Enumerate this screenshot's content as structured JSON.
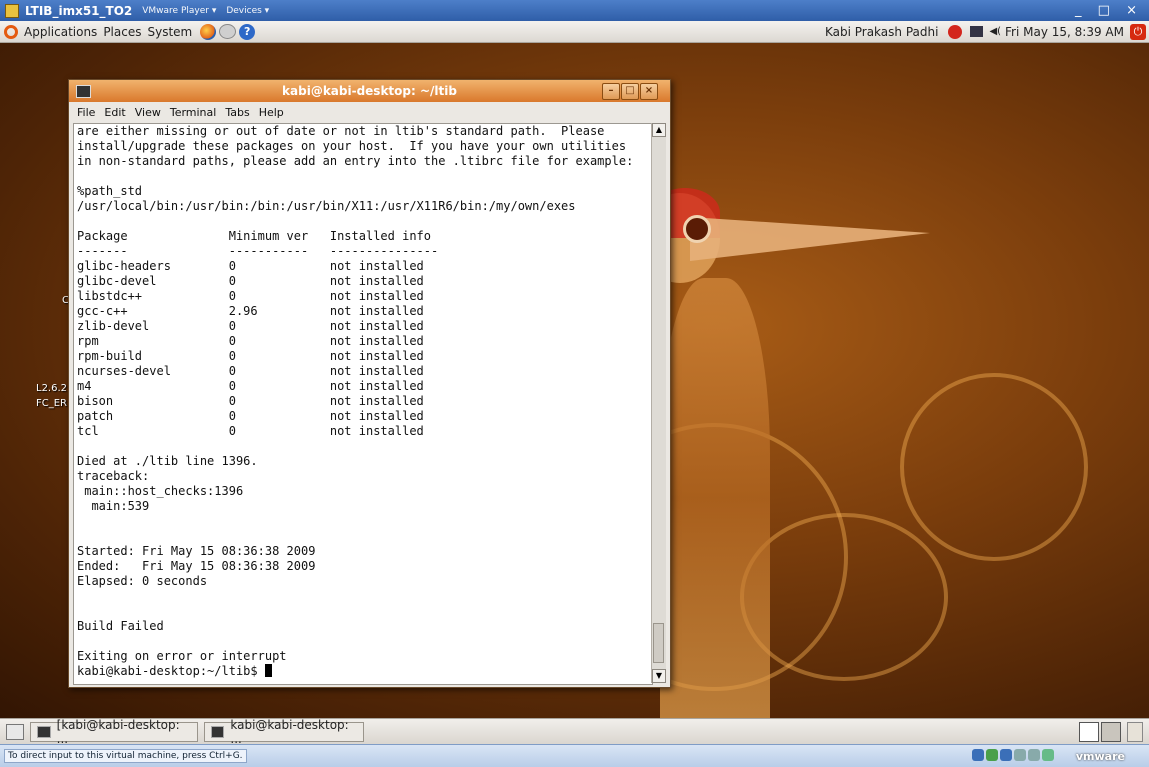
{
  "vm": {
    "title": "LTIB_imx51_TO2",
    "menu_player": "VMware Player ▾",
    "menu_devices": "Devices ▾",
    "controls": "_ □ ×"
  },
  "panel": {
    "applications": "Applications",
    "places": "Places",
    "system": "System",
    "help_icon": "?",
    "user": "Kabi Prakash Padhi",
    "volume_icon": "◀(",
    "clock": "Fri May 15,  8:39 AM",
    "power_icon": "⏻"
  },
  "desktop": {
    "icon_label_1": "L2.6.2",
    "icon_label_2": "FC_ER",
    "icon_label_3": "C"
  },
  "terminal": {
    "title": "kabi@kabi-desktop: ~/ltib",
    "minimize": "–",
    "maximize": "□",
    "close": "×",
    "menu": {
      "file": "File",
      "edit": "Edit",
      "view": "View",
      "terminal": "Terminal",
      "tabs": "Tabs",
      "help": "Help"
    },
    "output": "are either missing or out of date or not in ltib's standard path.  Please\ninstall/upgrade these packages on your host.  If you have your own utilities\nin non-standard paths, please add an entry into the .ltibrc file for example:\n\n%path_std\n/usr/local/bin:/usr/bin:/bin:/usr/bin/X11:/usr/X11R6/bin:/my/own/exes\n\nPackage              Minimum ver   Installed info\n-------              -----------   ---------------\nglibc-headers        0             not installed\nglibc-devel          0             not installed\nlibstdc++            0             not installed\ngcc-c++              2.96          not installed\nzlib-devel           0             not installed\nrpm                  0             not installed\nrpm-build            0             not installed\nncurses-devel        0             not installed\nm4                   0             not installed\nbison                0             not installed\npatch                0             not installed\ntcl                  0             not installed\n\nDied at ./ltib line 1396.\ntraceback:\n main::host_checks:1396\n  main:539\n\n\nStarted: Fri May 15 08:36:38 2009\nEnded:   Fri May 15 08:36:38 2009\nElapsed: 0 seconds\n\n\nBuild Failed\n\nExiting on error or interrupt\n",
    "prompt": "kabi@kabi-desktop:~/ltib$ ",
    "scroll_up": "▲",
    "scroll_down": "▼"
  },
  "taskbar": {
    "task1": "[kabi@kabi-desktop: ...",
    "task2": "kabi@kabi-desktop: ..."
  },
  "status": {
    "hint": "To direct input to this virtual machine, press Ctrl+G.",
    "brand": "vmware"
  }
}
